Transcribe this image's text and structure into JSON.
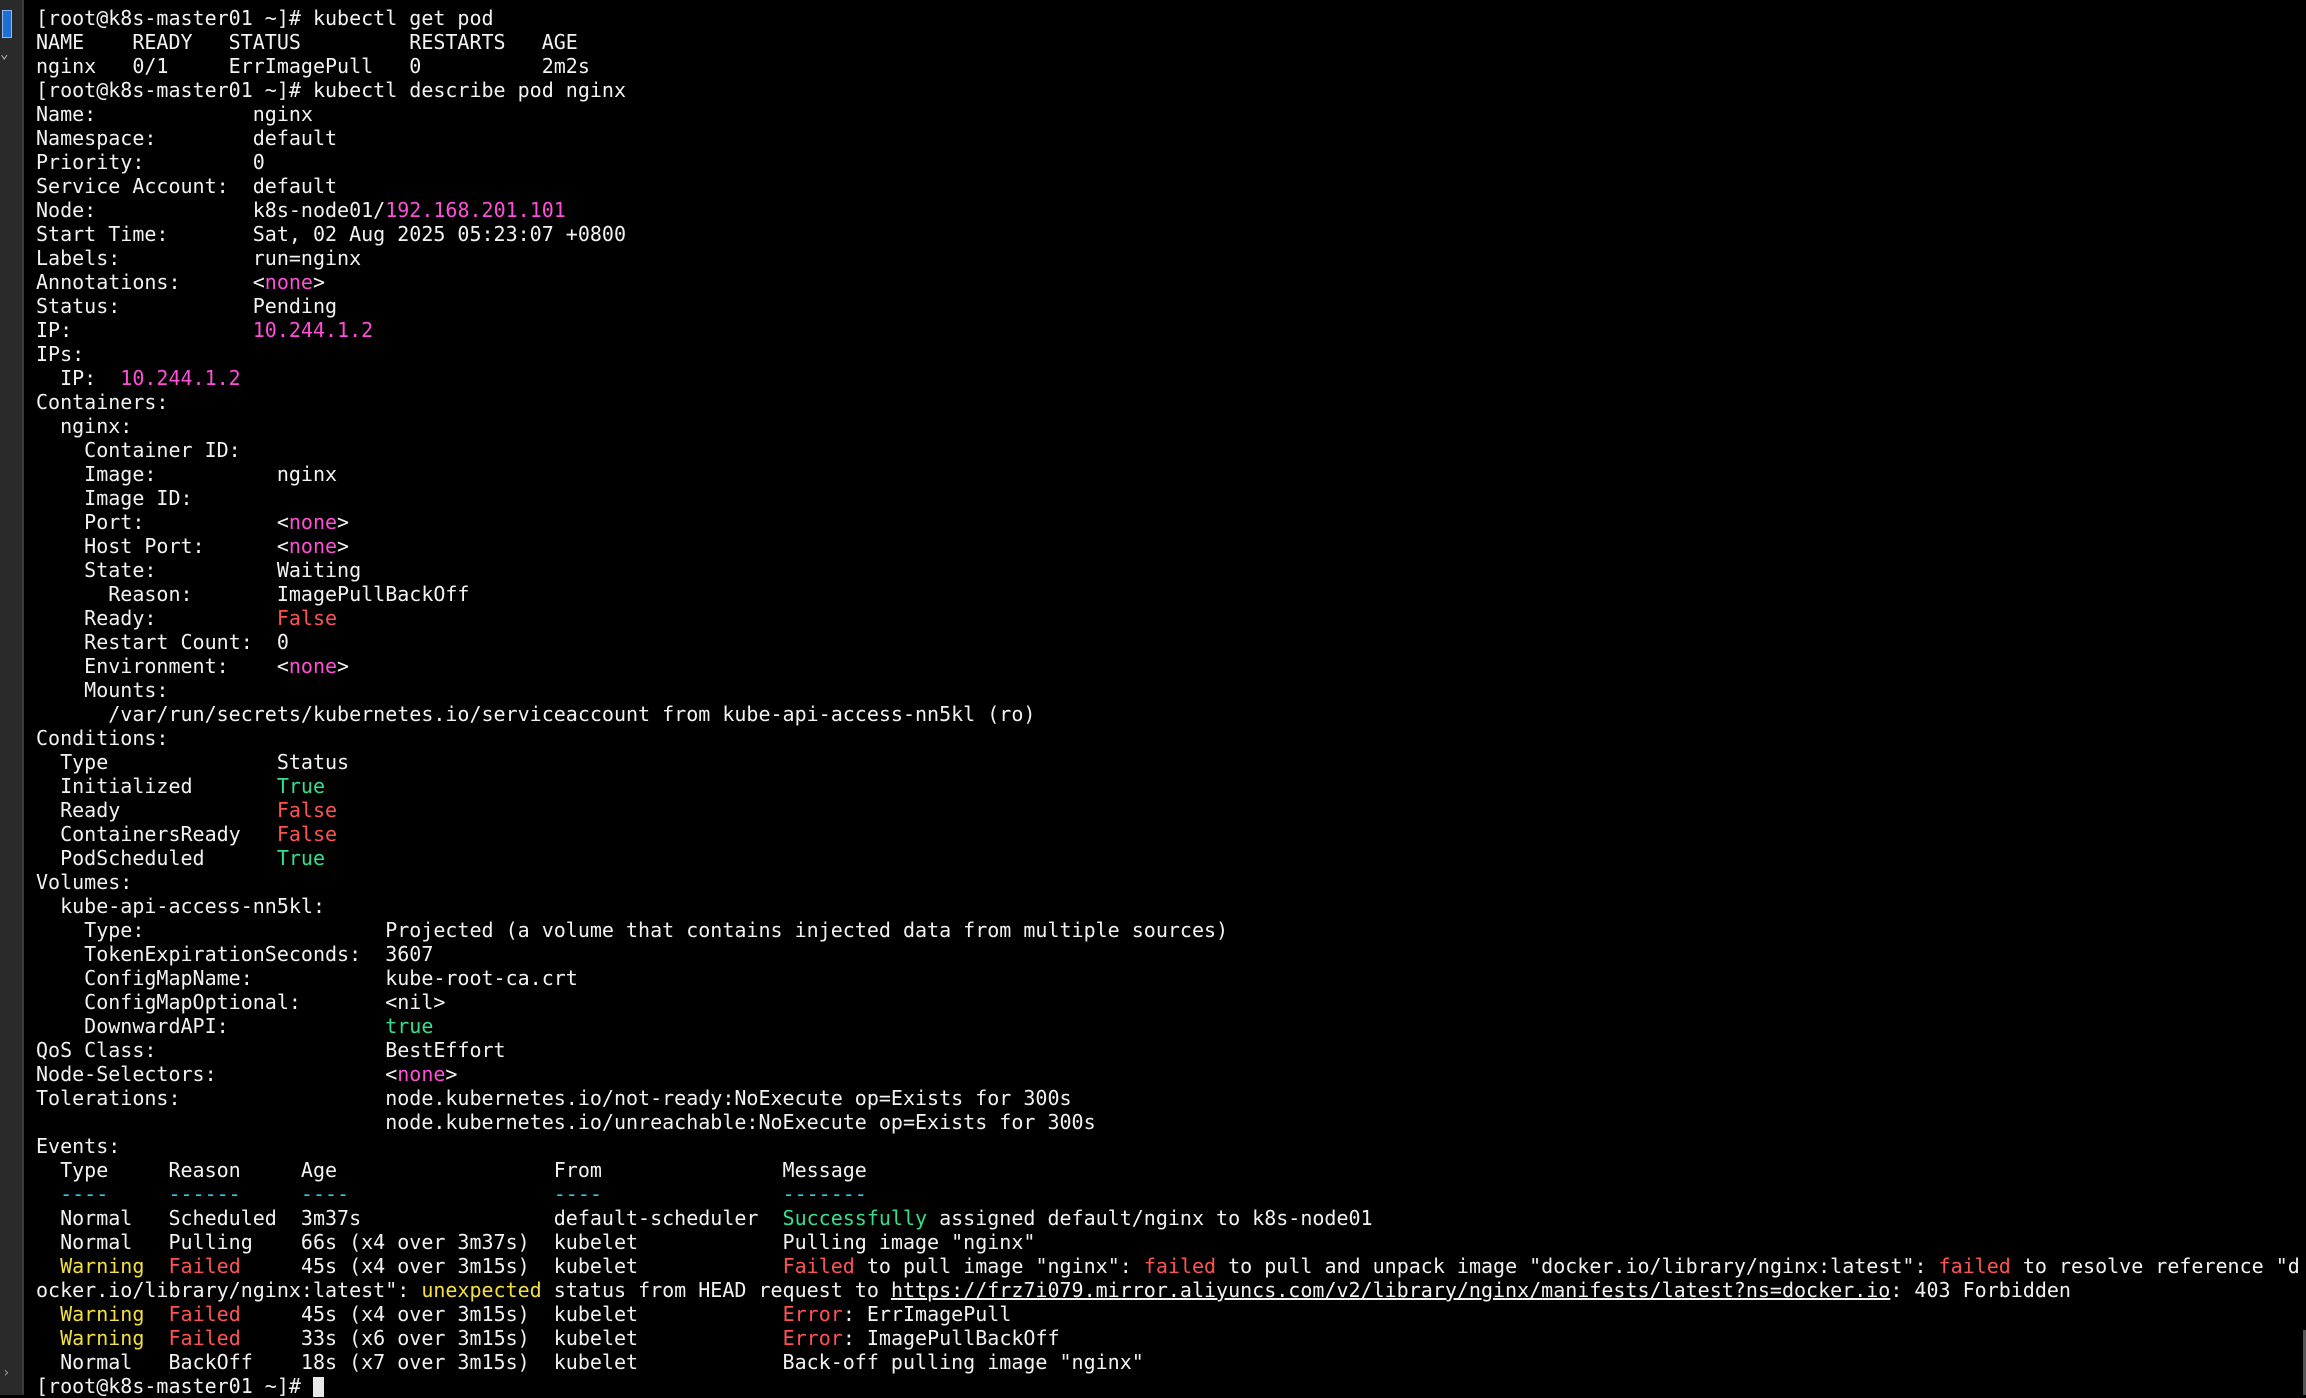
{
  "window": {
    "left_gutter": "terminal-gutter"
  },
  "terminal": {
    "lines": [
      [
        {
          "t": "[root@k8s-master01 ~]# kubectl get pod"
        }
      ],
      [
        {
          "t": "NAME    READY   STATUS         RESTARTS   AGE"
        }
      ],
      [
        {
          "t": "nginx   0/1     ErrImagePull   0          2m2s"
        }
      ],
      [
        {
          "t": "[root@k8s-master01 ~]# kubectl describe pod nginx"
        }
      ],
      [
        {
          "t": "Name:             nginx"
        }
      ],
      [
        {
          "t": "Namespace:        default"
        }
      ],
      [
        {
          "t": "Priority:         0"
        }
      ],
      [
        {
          "t": "Service Account:  default"
        }
      ],
      [
        {
          "t": "Node:             k8s-node01/"
        },
        {
          "t": "192.168.201.101",
          "c": "mg"
        }
      ],
      [
        {
          "t": "Start Time:       Sat, 02 Aug 2025 05:23:07 +0800"
        }
      ],
      [
        {
          "t": "Labels:           run=nginx"
        }
      ],
      [
        {
          "t": "Annotations:      <"
        },
        {
          "t": "none",
          "c": "mg"
        },
        {
          "t": ">"
        }
      ],
      [
        {
          "t": "Status:           Pending"
        }
      ],
      [
        {
          "t": "IP:               "
        },
        {
          "t": "10.244.1.2",
          "c": "mg"
        }
      ],
      [
        {
          "t": "IPs:"
        }
      ],
      [
        {
          "t": "  IP:  "
        },
        {
          "t": "10.244.1.2",
          "c": "mg"
        }
      ],
      [
        {
          "t": "Containers:"
        }
      ],
      [
        {
          "t": "  nginx:"
        }
      ],
      [
        {
          "t": "    Container ID:"
        }
      ],
      [
        {
          "t": "    Image:          nginx"
        }
      ],
      [
        {
          "t": "    Image ID:"
        }
      ],
      [
        {
          "t": "    Port:           <"
        },
        {
          "t": "none",
          "c": "mg"
        },
        {
          "t": ">"
        }
      ],
      [
        {
          "t": "    Host Port:      <"
        },
        {
          "t": "none",
          "c": "mg"
        },
        {
          "t": ">"
        }
      ],
      [
        {
          "t": "    State:          Waiting"
        }
      ],
      [
        {
          "t": "      Reason:       ImagePullBackOff"
        }
      ],
      [
        {
          "t": "    Ready:          "
        },
        {
          "t": "False",
          "c": "rd"
        }
      ],
      [
        {
          "t": "    Restart Count:  0"
        }
      ],
      [
        {
          "t": "    Environment:    <"
        },
        {
          "t": "none",
          "c": "mg"
        },
        {
          "t": ">"
        }
      ],
      [
        {
          "t": "    Mounts:"
        }
      ],
      [
        {
          "t": "      /var/run/secrets/kubernetes.io/serviceaccount from kube-api-access-nn5kl (ro)"
        }
      ],
      [
        {
          "t": "Conditions:"
        }
      ],
      [
        {
          "t": "  Type              Status"
        }
      ],
      [
        {
          "t": "  Initialized       "
        },
        {
          "t": "True",
          "c": "gn"
        }
      ],
      [
        {
          "t": "  Ready             "
        },
        {
          "t": "False",
          "c": "rd"
        }
      ],
      [
        {
          "t": "  ContainersReady   "
        },
        {
          "t": "False",
          "c": "rd"
        }
      ],
      [
        {
          "t": "  PodScheduled      "
        },
        {
          "t": "True",
          "c": "gn"
        }
      ],
      [
        {
          "t": "Volumes:"
        }
      ],
      [
        {
          "t": "  kube-api-access-nn5kl:"
        }
      ],
      [
        {
          "t": "    Type:                    Projected (a volume that contains injected data from multiple sources)"
        }
      ],
      [
        {
          "t": "    TokenExpirationSeconds:  3607"
        }
      ],
      [
        {
          "t": "    ConfigMapName:           kube-root-ca.crt"
        }
      ],
      [
        {
          "t": "    ConfigMapOptional:       <nil>"
        }
      ],
      [
        {
          "t": "    DownwardAPI:             "
        },
        {
          "t": "true",
          "c": "gn"
        }
      ],
      [
        {
          "t": "QoS Class:                   BestEffort"
        }
      ],
      [
        {
          "t": "Node-Selectors:              <"
        },
        {
          "t": "none",
          "c": "mg"
        },
        {
          "t": ">"
        }
      ],
      [
        {
          "t": "Tolerations:                 node.kubernetes.io/not-ready:NoExecute op=Exists for 300s"
        }
      ],
      [
        {
          "t": "                             node.kubernetes.io/unreachable:NoExecute op=Exists for 300s"
        }
      ],
      [
        {
          "t": "Events:"
        }
      ],
      [
        {
          "t": "  Type     Reason     Age                  From               Message"
        }
      ],
      [
        {
          "t": "  ----     ------     ----                 ----               -------",
          "c": "cy"
        }
      ],
      [
        {
          "t": "  Normal   Scheduled  3m37s                default-scheduler  "
        },
        {
          "t": "Successfully",
          "c": "gn"
        },
        {
          "t": " assigned default/nginx to k8s-node01"
        }
      ],
      [
        {
          "t": "  Normal   Pulling    66s (x4 over 3m37s)  kubelet            Pulling image \"nginx\""
        }
      ],
      [
        {
          "t": "  "
        },
        {
          "t": "Warning",
          "c": "yl"
        },
        {
          "t": "  "
        },
        {
          "t": "Failed",
          "c": "rd"
        },
        {
          "t": "     45s (x4 over 3m15s)  kubelet            "
        },
        {
          "t": "Failed",
          "c": "rd"
        },
        {
          "t": " to pull image \"nginx\": "
        },
        {
          "t": "failed",
          "c": "rd"
        },
        {
          "t": " to pull and unpack image \"docker.io/library/nginx:latest\": "
        },
        {
          "t": "failed",
          "c": "rd"
        },
        {
          "t": " to resolve reference \"d"
        }
      ],
      [
        {
          "t": "ocker.io/library/nginx:latest\": "
        },
        {
          "t": "unexpected",
          "c": "yl"
        },
        {
          "t": " status from HEAD request to "
        },
        {
          "t": "https://frz7i079.mirror.aliyuncs.com/v2/library/nginx/manifests/latest?ns=docker.io",
          "c": "ul"
        },
        {
          "t": ": 403 Forbidden"
        }
      ],
      [
        {
          "t": "  "
        },
        {
          "t": "Warning",
          "c": "yl"
        },
        {
          "t": "  "
        },
        {
          "t": "Failed",
          "c": "rd"
        },
        {
          "t": "     45s (x4 over 3m15s)  kubelet            "
        },
        {
          "t": "Error",
          "c": "rd"
        },
        {
          "t": ": ErrImagePull"
        }
      ],
      [
        {
          "t": "  "
        },
        {
          "t": "Warning",
          "c": "yl"
        },
        {
          "t": "  "
        },
        {
          "t": "Failed",
          "c": "rd"
        },
        {
          "t": "     33s (x6 over 3m15s)  kubelet            "
        },
        {
          "t": "Error",
          "c": "rd"
        },
        {
          "t": ": ImagePullBackOff"
        }
      ],
      [
        {
          "t": "  Normal   BackOff    18s (x7 over 3m15s)  kubelet            Back-off pulling image \"nginx\""
        }
      ],
      [
        {
          "t": "[root@k8s-master01 ~]# "
        },
        {
          "cursor": true
        }
      ]
    ]
  }
}
